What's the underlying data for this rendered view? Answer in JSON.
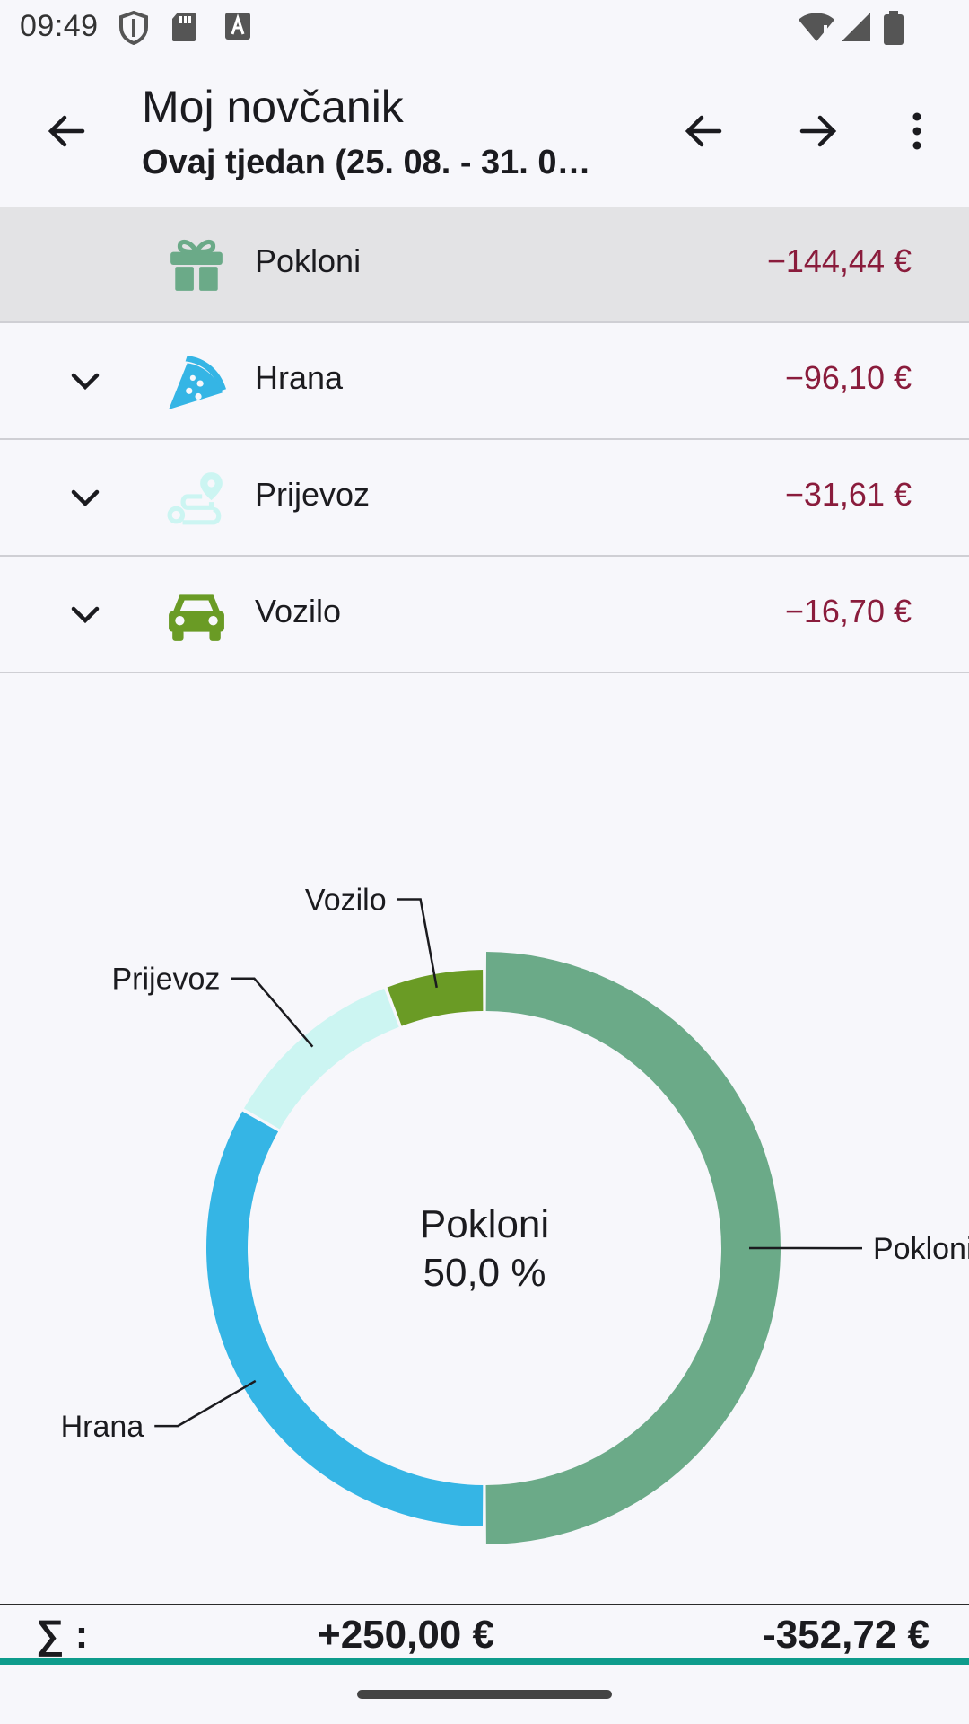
{
  "status": {
    "time": "09:49"
  },
  "header": {
    "title": "Moj novčanik",
    "subtitle": "Ovaj tjedan (25. 08. - 31. 0…"
  },
  "icons": {
    "back": "arrow-left-icon",
    "prev": "arrow-left-icon",
    "next": "arrow-right-icon",
    "more": "more-vert-icon"
  },
  "categories": [
    {
      "label": "Pokloni",
      "amount": "−144,44 €",
      "icon": "gift-icon",
      "color": "#6BAA88",
      "expandable": false,
      "selected": true
    },
    {
      "label": "Hrana",
      "amount": "−96,10 €",
      "icon": "pizza-icon",
      "color": "#35B5E5",
      "expandable": true,
      "selected": false
    },
    {
      "label": "Prijevoz",
      "amount": "−31,61 €",
      "icon": "route-icon",
      "color": "#CCF5F2",
      "expandable": true,
      "selected": false
    },
    {
      "label": "Vozilo",
      "amount": "−16,70 €",
      "icon": "car-icon",
      "color": "#6A9B25",
      "expandable": true,
      "selected": false
    }
  ],
  "chart_data": {
    "type": "pie",
    "labels": [
      "Pokloni",
      "Hrana",
      "Prijevoz",
      "Vozilo"
    ],
    "values": [
      144.44,
      96.1,
      31.61,
      16.7
    ],
    "colors": [
      "#6BAA88",
      "#35B5E5",
      "#CCF5F2",
      "#6A9B25"
    ],
    "center_label": "Pokloni",
    "center_value": "50,0 %",
    "selected": "Pokloni"
  },
  "footer": {
    "sum_label": "∑ :",
    "income": "+250,00 €",
    "expense": "-352,72 €"
  }
}
